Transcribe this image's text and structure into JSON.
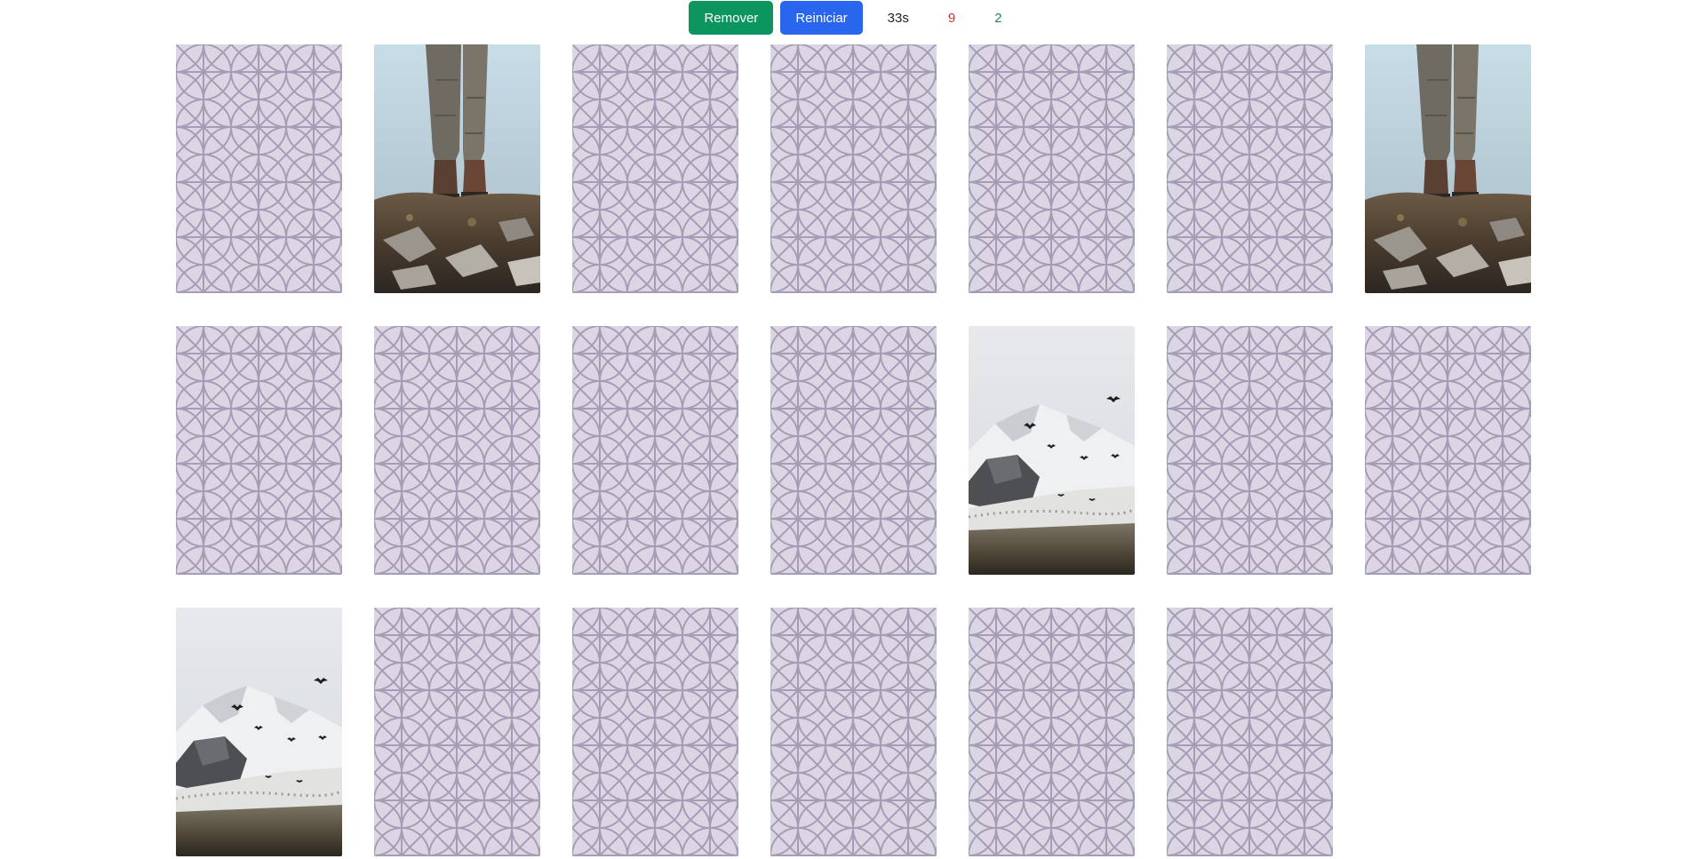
{
  "toolbar": {
    "remove_label": "Remover",
    "restart_label": "Reiniciar",
    "time": "33s",
    "errors": "9",
    "hits": "2"
  },
  "colors": {
    "remove_button": "#0d9560",
    "restart_button": "#2a65ee",
    "errors_text": "#d32f2f",
    "hits_text": "#1b8a5a",
    "card_back": "#dcd6e4",
    "card_pattern": "#a59db5"
  },
  "cards": [
    {
      "state": "hidden"
    },
    {
      "state": "revealed",
      "image": "boots-on-rocks"
    },
    {
      "state": "hidden"
    },
    {
      "state": "hidden"
    },
    {
      "state": "hidden"
    },
    {
      "state": "hidden"
    },
    {
      "state": "revealed",
      "image": "boots-on-rocks"
    },
    {
      "state": "hidden"
    },
    {
      "state": "hidden"
    },
    {
      "state": "hidden"
    },
    {
      "state": "hidden"
    },
    {
      "state": "revealed",
      "image": "snowy-mountain-birds"
    },
    {
      "state": "hidden"
    },
    {
      "state": "hidden"
    },
    {
      "state": "revealed",
      "image": "snowy-mountain-birds"
    },
    {
      "state": "hidden"
    },
    {
      "state": "hidden"
    },
    {
      "state": "hidden"
    },
    {
      "state": "hidden"
    },
    {
      "state": "hidden"
    }
  ]
}
